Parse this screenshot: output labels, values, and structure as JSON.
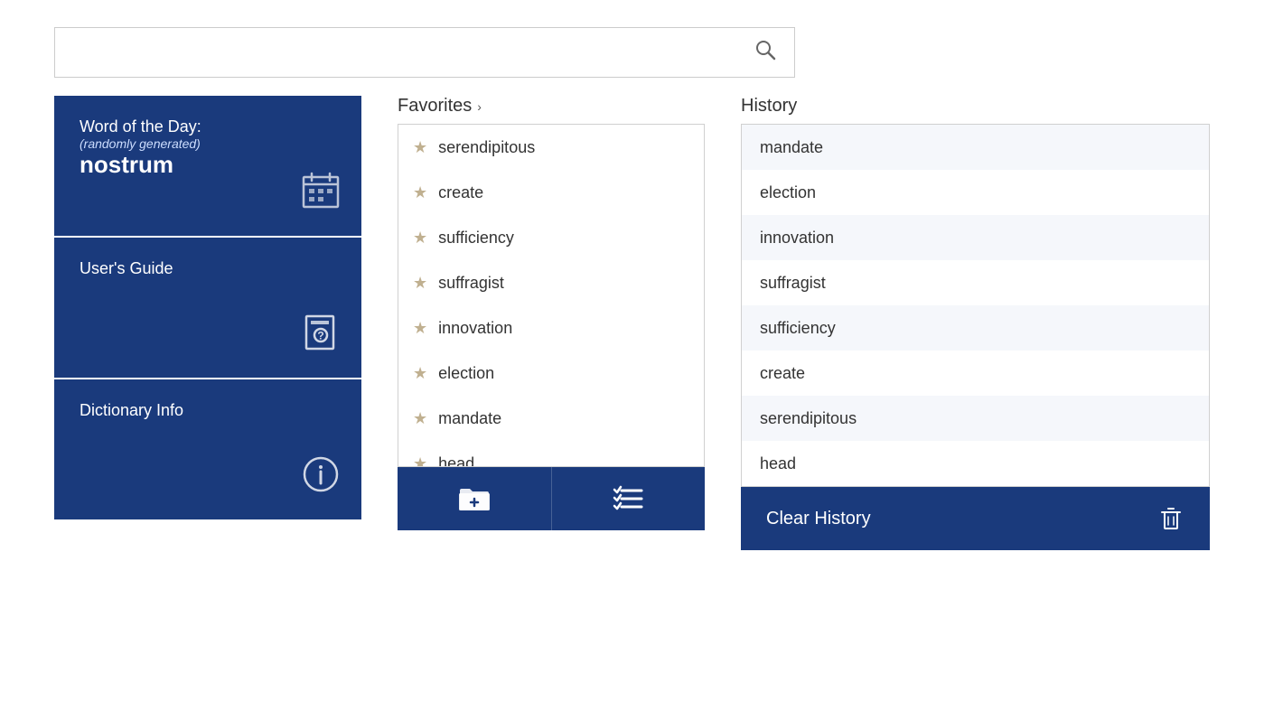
{
  "search": {
    "placeholder": "",
    "value": ""
  },
  "sidebar": {
    "word_of_day_label": "Word of the Day:",
    "word_of_day_subtitle": "(randomly generated)",
    "word_of_day_word": "nostrum",
    "users_guide_label": "User's Guide",
    "dictionary_info_label": "Dictionary Info"
  },
  "favorites": {
    "header": "Favorites",
    "chevron": "›",
    "items": [
      "serendipitous",
      "create",
      "sufficiency",
      "suffragist",
      "innovation",
      "election",
      "mandate",
      "head"
    ],
    "add_button_label": "add-favorites",
    "manage_button_label": "manage-favorites"
  },
  "history": {
    "header": "History",
    "items": [
      "mandate",
      "election",
      "innovation",
      "suffragist",
      "sufficiency",
      "create",
      "serendipitous",
      "head"
    ],
    "clear_label": "Clear History"
  }
}
